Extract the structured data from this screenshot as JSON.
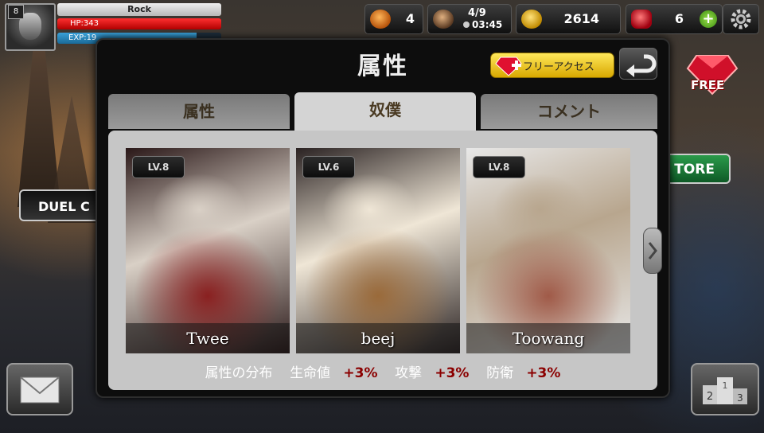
{
  "hud": {
    "level": "8",
    "player_name": "Rock",
    "hp_text": "HP:343",
    "hp_fraction": 1.0,
    "exp_text": "EXP:19",
    "exp_fraction": 0.85,
    "helmet_count": "4",
    "energy_fraction": "4/9",
    "energy_timer": "03:45",
    "gold": "2614",
    "gems": "6"
  },
  "outside": {
    "duel_label": "DUEL C",
    "store_label": "TORE",
    "free_badge": "FREE"
  },
  "modal": {
    "title": "属性",
    "free_access_label": "フリーアクセス",
    "tabs": [
      {
        "label": "属性",
        "active": false
      },
      {
        "label": "奴僕",
        "active": true
      },
      {
        "label": "コメント",
        "active": false
      }
    ],
    "cards": [
      {
        "level": "LV.8",
        "name": "Twee",
        "palette": [
          "#d9d0c6",
          "#8a2020",
          "#2a1818"
        ]
      },
      {
        "level": "LV.6",
        "name": "beej",
        "palette": [
          "#efe6d6",
          "#9a6a3a",
          "#2a2222"
        ]
      },
      {
        "level": "LV.8",
        "name": "Toowang",
        "palette": [
          "#b8a68e",
          "#a05a48",
          "#e8e8e8"
        ]
      }
    ],
    "stats": {
      "title": "属性の分布",
      "hp_label": "生命値",
      "hp_bonus": "+3%",
      "attack_label": "攻撃",
      "attack_bonus": "+3%",
      "defense_label": "防衛",
      "defense_bonus": "+3%"
    }
  }
}
